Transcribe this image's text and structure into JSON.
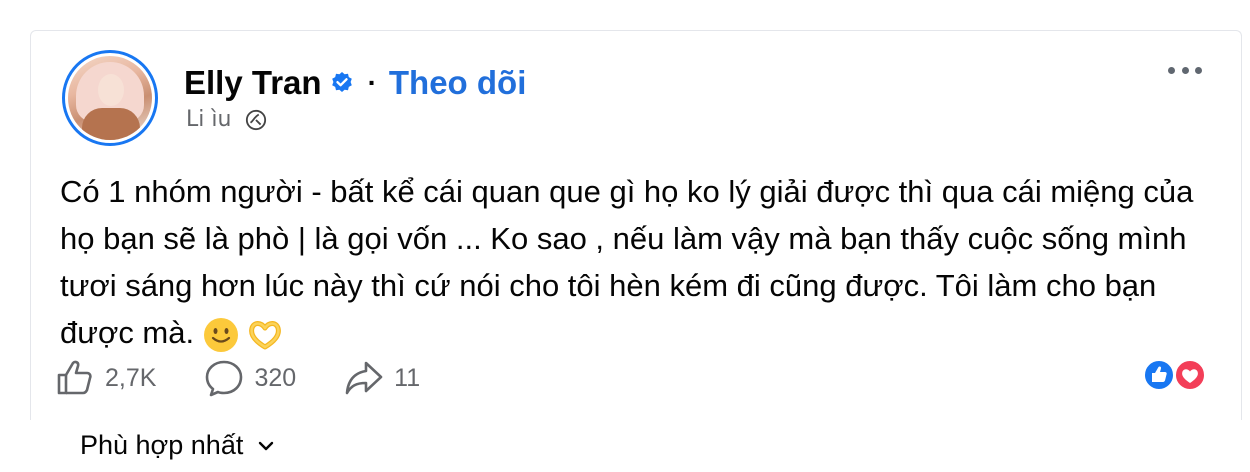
{
  "post": {
    "author": "Elly Tran",
    "separator": "·",
    "follow_label": "Theo dõi",
    "timestamp": "Li ìu",
    "text": "Có 1 nhóm người - bất kể cái quan que gì họ ko lý giải được thì qua cái miệng của họ bạn sẽ là phò | là gọi vốn ... Ko sao , nếu làm vậy mà bạn thấy cuộc sống mình tươi sáng hơn lúc này thì cứ nói cho tôi hèn kém đi cũng được. Tôi làm cho bạn được mà."
  },
  "icons": {
    "verified": "verified-badge-icon",
    "globe": "globe-icon",
    "more": "more-options-icon",
    "smile": "smiling-face-emoji",
    "heart_hands": "heart-hands-emoji",
    "like": "like-icon",
    "comment": "comment-icon",
    "share": "share-icon",
    "sort": "chevron-down-icon"
  },
  "stats": {
    "likes": "2,7K",
    "comments": "320",
    "shares": "11"
  },
  "comments_sort": {
    "label": "Phù hợp nhất"
  },
  "colors": {
    "accent": "#1877f2",
    "follow": "#216fdb",
    "muted": "#65676b",
    "love": "#f33e58"
  }
}
